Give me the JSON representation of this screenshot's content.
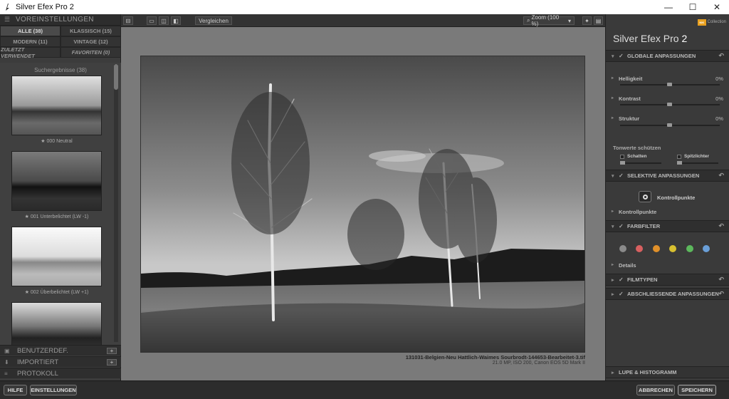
{
  "window": {
    "title": "Silver Efex Pro 2",
    "minimize": "—",
    "maximize": "☐",
    "close": "✕"
  },
  "left": {
    "header": "VOREINSTELLUNGEN",
    "tabs": [
      "ALLE (38)",
      "KLASSISCH (15)",
      "MODERN (11)",
      "VINTAGE (12)",
      "ZULETZT VERWENDET",
      "FAVORITEN (0)"
    ],
    "results_title": "Suchergebnisse (38)",
    "presets": [
      "★ 000 Neutral",
      "★ 001 Unterbelichtet (LW -1)",
      "★ 002 Überbelichtet (LW +1)"
    ],
    "sections": [
      "BENUTZERDEF.",
      "IMPORTIERT",
      "PROTOKOLL"
    ]
  },
  "toolbar": {
    "compare": "Vergleichen",
    "zoom": "Zoom (100 %)"
  },
  "image": {
    "filename": "131031-Belgien-Neu Hattlich-Waimes Sourbrodt-144653-Bearbeitet-3.tif",
    "meta": "21.0 MP, ISO 200, Canon EOS 5D Mark II"
  },
  "right": {
    "logo_badge": "NIK",
    "logo_text": "Collection",
    "app_name": "Silver Efex Pro",
    "app_version": "2",
    "global_title": "GLOBALE ANPASSUNGEN",
    "helligkeit": {
      "label": "Helligkeit",
      "value": "0%"
    },
    "kontrast": {
      "label": "Kontrast",
      "value": "0%"
    },
    "struktur": {
      "label": "Struktur",
      "value": "0%"
    },
    "tonwerte": "Tonwerte schützen",
    "schatten": "Schatten",
    "spitzlichter": "Spitzlichter",
    "selective_title": "SELEKTIVE ANPASSUNGEN",
    "kontrollpunkte_btn": "Kontrollpunkte",
    "kontrollpunkte_row": "Kontrollpunkte",
    "farbfilter_title": "FARBFILTER",
    "filter_colors": [
      "#8a8a8a",
      "#d86060",
      "#e0902a",
      "#d8c030",
      "#5cb85c",
      "#6a9fd8"
    ],
    "details": "Details",
    "filmtypen": "FILMTYPEN",
    "abschliessende": "ABSCHLIESSENDE ANPASSUNGEN",
    "lupe": "LUPE & HISTOGRAMM"
  },
  "bottom": {
    "help": "HILFE",
    "settings": "EINSTELLUNGEN",
    "cancel": "ABBRECHEN",
    "save": "SPEICHERN"
  }
}
